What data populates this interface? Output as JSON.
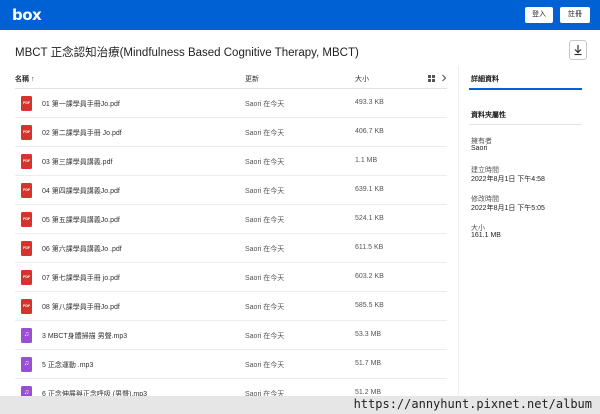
{
  "header": {
    "logo_text": "box",
    "login_label": "登入",
    "register_label": "註冊",
    "brand_color": "#0061d5"
  },
  "folder": {
    "title": "MBCT 正念認知治療(Mindfulness Based Cognitive Therapy, MBCT)",
    "download_icon": "download-icon"
  },
  "columns": {
    "name": "名稱",
    "sort_indicator": "↑",
    "updated": "更新",
    "size": "大小"
  },
  "files": [
    {
      "name": "01 第一課學員手冊Jo.pdf",
      "updated": "Saori 在今天",
      "size": "493.3 KB",
      "type": "pdf",
      "type_label": "PDF"
    },
    {
      "name": "02 第二課學員手冊 Jo.pdf",
      "updated": "Saori 在今天",
      "size": "406.7 KB",
      "type": "pdf",
      "type_label": "PDF"
    },
    {
      "name": "03 第三課學員講義.pdf",
      "updated": "Saori 在今天",
      "size": "1.1 MB",
      "type": "pdf",
      "type_label": "PDF"
    },
    {
      "name": "04 第四課學員講義Jo.pdf",
      "updated": "Saori 在今天",
      "size": "639.1 KB",
      "type": "pdf",
      "type_label": "PDF"
    },
    {
      "name": "05 第五課學員講義Jo.pdf",
      "updated": "Saori 在今天",
      "size": "524.1 KB",
      "type": "pdf",
      "type_label": "PDF"
    },
    {
      "name": "06 第六課學員講義Jo .pdf",
      "updated": "Saori 在今天",
      "size": "611.5 KB",
      "type": "pdf",
      "type_label": "PDF"
    },
    {
      "name": "07 第七課學員手冊 jo.pdf",
      "updated": "Saori 在今天",
      "size": "603.2 KB",
      "type": "pdf",
      "type_label": "PDF"
    },
    {
      "name": "08 第八課學員手冊Jo.pdf",
      "updated": "Saori 在今天",
      "size": "585.5 KB",
      "type": "pdf",
      "type_label": "PDF"
    },
    {
      "name": "3 MBCT身體掃描 男聲.mp3",
      "updated": "Saori 在今天",
      "size": "53.3 MB",
      "type": "mp3",
      "type_label": "♫"
    },
    {
      "name": "5 正念運動 .mp3",
      "updated": "Saori 在今天",
      "size": "51.7 MB",
      "type": "mp3",
      "type_label": "♫"
    },
    {
      "name": "6 正念伸展與正念呼吸 (男聲).mp3",
      "updated": "Saori 在今天",
      "size": "51.2 MB",
      "type": "mp3",
      "type_label": "♫"
    }
  ],
  "sidebar": {
    "tab_label": "詳細資料",
    "section_title": "資料夾屬性",
    "owner_label": "擁有者",
    "owner_value": "Saori",
    "created_label": "建立時間",
    "created_value": "2022年8月1日 下午4:58",
    "modified_label": "修改時間",
    "modified_value": "2022年8月1日 下午5:05",
    "size_label": "大小",
    "size_value": "161.1 MB"
  },
  "watermark": {
    "text": "https://annyhunt.pixnet.net/album"
  }
}
